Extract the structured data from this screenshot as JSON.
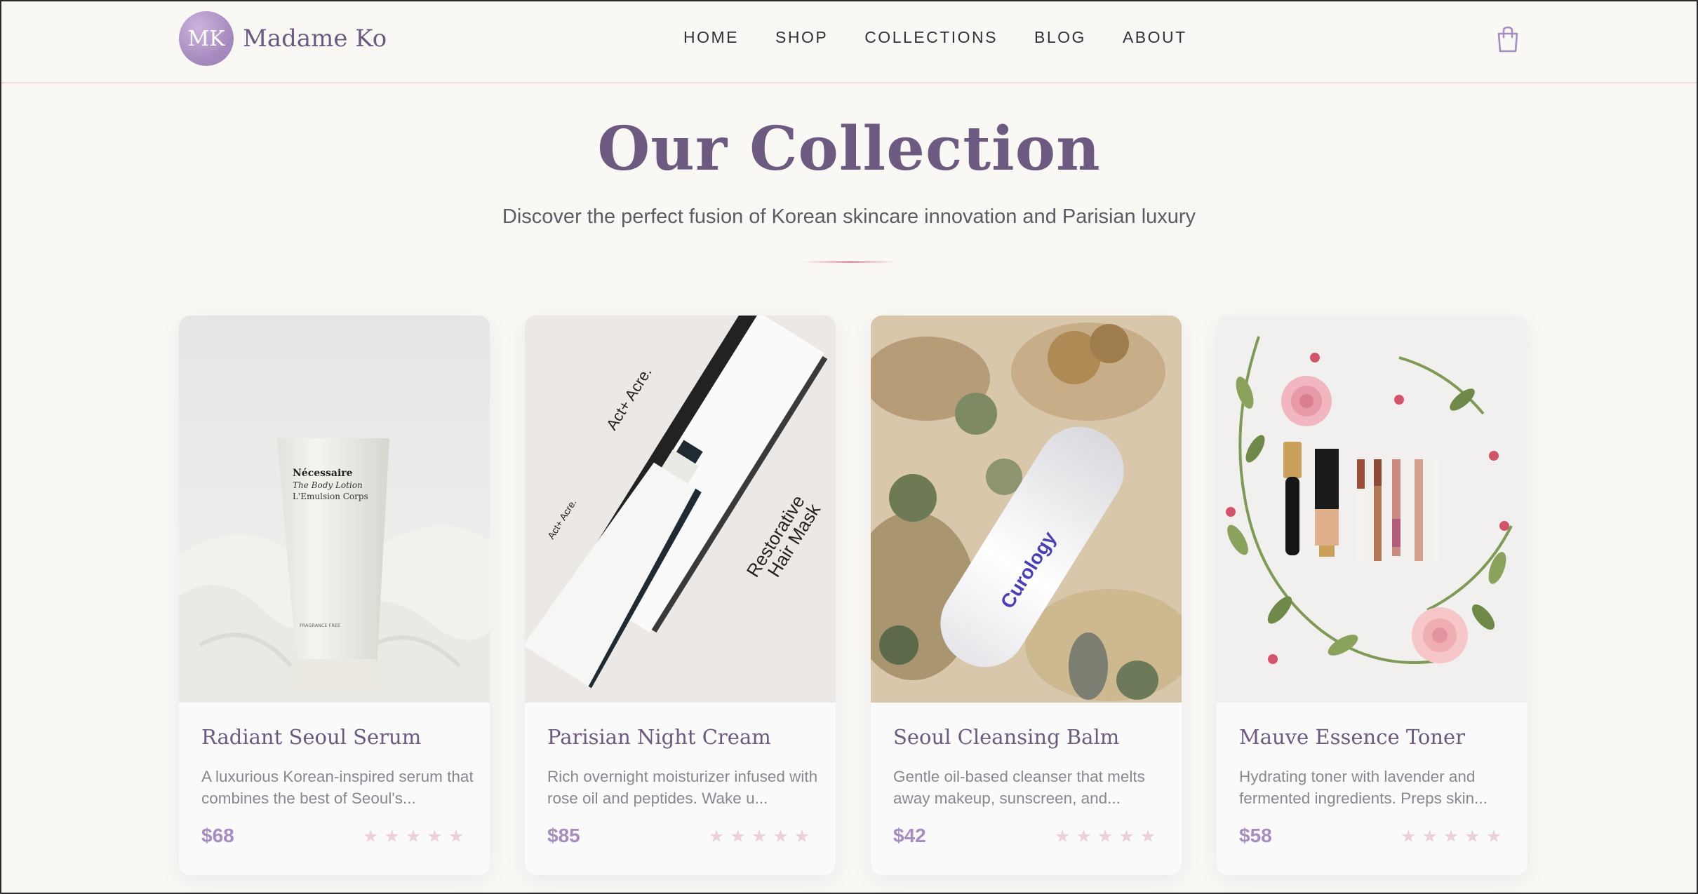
{
  "brand": {
    "initials": "MK",
    "name": "Madame Ko"
  },
  "nav": [
    "HOME",
    "SHOP",
    "COLLECTIONS",
    "BLOG",
    "ABOUT"
  ],
  "hero": {
    "title": "Our Collection",
    "subtitle": "Discover the perfect fusion of Korean skincare innovation and Parisian luxury"
  },
  "products": [
    {
      "name": "Radiant Seoul Serum",
      "description": "A luxurious Korean-inspired serum that combines the best of Seoul's...",
      "price": "$68",
      "rating": 0,
      "image": {
        "brand_line1": "Nécessaire",
        "brand_line2": "The Body Lotion",
        "brand_line3": "L'Emulsion Corps",
        "small_text": "FRAGRANCE FREE"
      }
    },
    {
      "name": "Parisian Night Cream",
      "description": "Rich overnight moisturizer infused with rose oil and peptides. Wake u...",
      "price": "$85",
      "rating": 0,
      "image": {
        "box_brand": "Act+ Acre.",
        "box_label_line1": "Restorative",
        "box_label_line2": "Hair Mask",
        "tube_brand": "Act+ Acre."
      }
    },
    {
      "name": "Seoul Cleansing Balm",
      "description": "Gentle oil-based cleanser that melts away makeup, sunscreen, and...",
      "price": "$42",
      "rating": 0,
      "image": {
        "bottle_brand": "Curology"
      }
    },
    {
      "name": "Mauve Essence Toner",
      "description": "Hydrating toner with lavender and fermented ingredients. Preps skin...",
      "price": "$58",
      "rating": 0,
      "image": {}
    }
  ],
  "icons": {
    "cart": "shopping-bag-icon",
    "star": "star-icon"
  },
  "colors": {
    "accent": "#6c5a80",
    "price": "#a58dbf",
    "star": "#ead2d7",
    "divider": "#e39aa5"
  }
}
